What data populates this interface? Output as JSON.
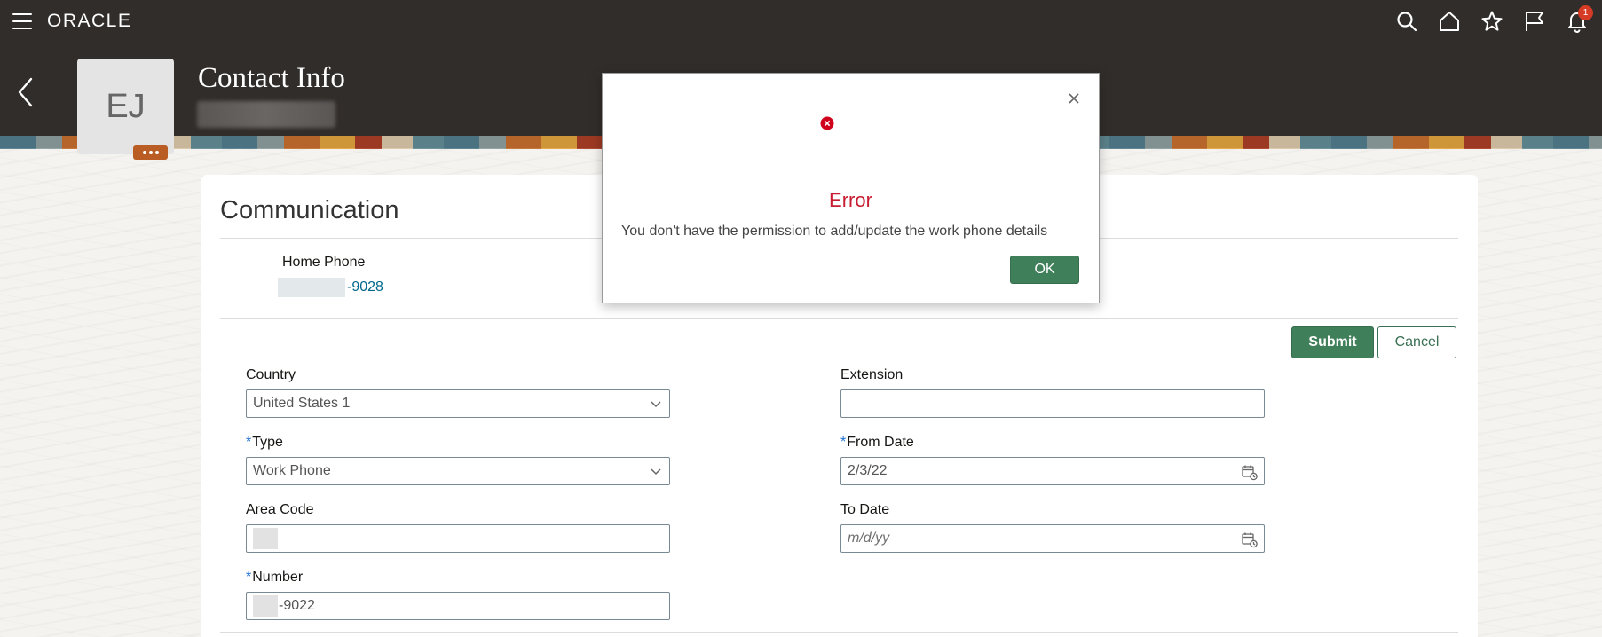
{
  "app": {
    "brand": "ORACLE"
  },
  "topbar": {
    "notification_count": "1"
  },
  "header": {
    "title": "Contact Info",
    "avatar_initials": "EJ"
  },
  "section": {
    "title": "Communication"
  },
  "home_phone": {
    "label": "Home Phone",
    "value": "-9028"
  },
  "actions": {
    "submit_label": "Submit",
    "cancel_label": "Cancel"
  },
  "form": {
    "country": {
      "label": "Country",
      "value": "United States 1"
    },
    "type": {
      "label": "Type",
      "value": "Work Phone",
      "required": "*"
    },
    "area_code": {
      "label": "Area Code",
      "value": ""
    },
    "number": {
      "label": "Number",
      "value": "-9022",
      "required": "*"
    },
    "extension": {
      "label": "Extension",
      "value": ""
    },
    "from_date": {
      "label": "From Date",
      "value": "2/3/22",
      "required": "*"
    },
    "to_date": {
      "label": "To Date",
      "placeholder": "m/d/yy"
    }
  },
  "dialog": {
    "title": "Error",
    "message": "You don't have the permission to add/update the work phone details",
    "ok_label": "OK"
  },
  "colors": {
    "header_bg": "#312d2a",
    "primary_button": "#3f7f5a",
    "error": "#c71d30",
    "link": "#00688c"
  }
}
